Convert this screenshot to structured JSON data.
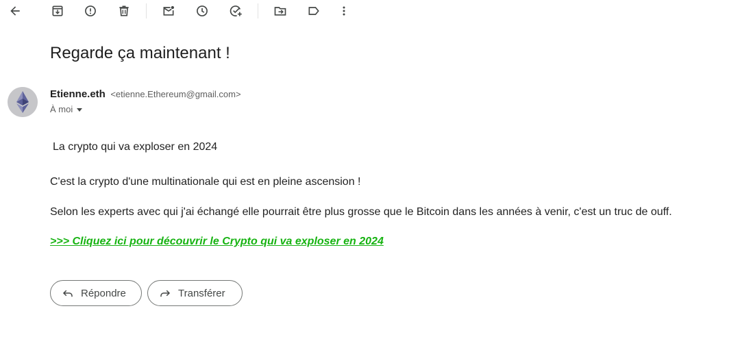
{
  "toolbar": {
    "icons": [
      "back-arrow-icon",
      "archive-icon",
      "report-spam-icon",
      "delete-icon",
      "mark-unread-icon",
      "snooze-icon",
      "add-task-icon",
      "move-to-icon",
      "label-icon",
      "more-vert-icon"
    ]
  },
  "email": {
    "subject": "Regarde ça maintenant !",
    "sender_name": "Etienne.eth",
    "sender_email": "<etienne.Ethereum@gmail.com>",
    "recipient": "À moi",
    "body": {
      "line1": "La crypto qui va exploser en 2024",
      "line2": "C'est la crypto d'une multinationale qui est en pleine ascension !",
      "line3": "Selon les experts avec qui j'ai échangé elle pourrait être plus grosse que le Bitcoin dans les années à venir, c'est un truc de ouff.",
      "link": ">>> Cliquez ici pour découvrir le Crypto qui va exploser en 2024"
    },
    "link_color": "#17b312"
  },
  "actions": {
    "reply_label": "Répondre",
    "forward_label": "Transférer"
  }
}
